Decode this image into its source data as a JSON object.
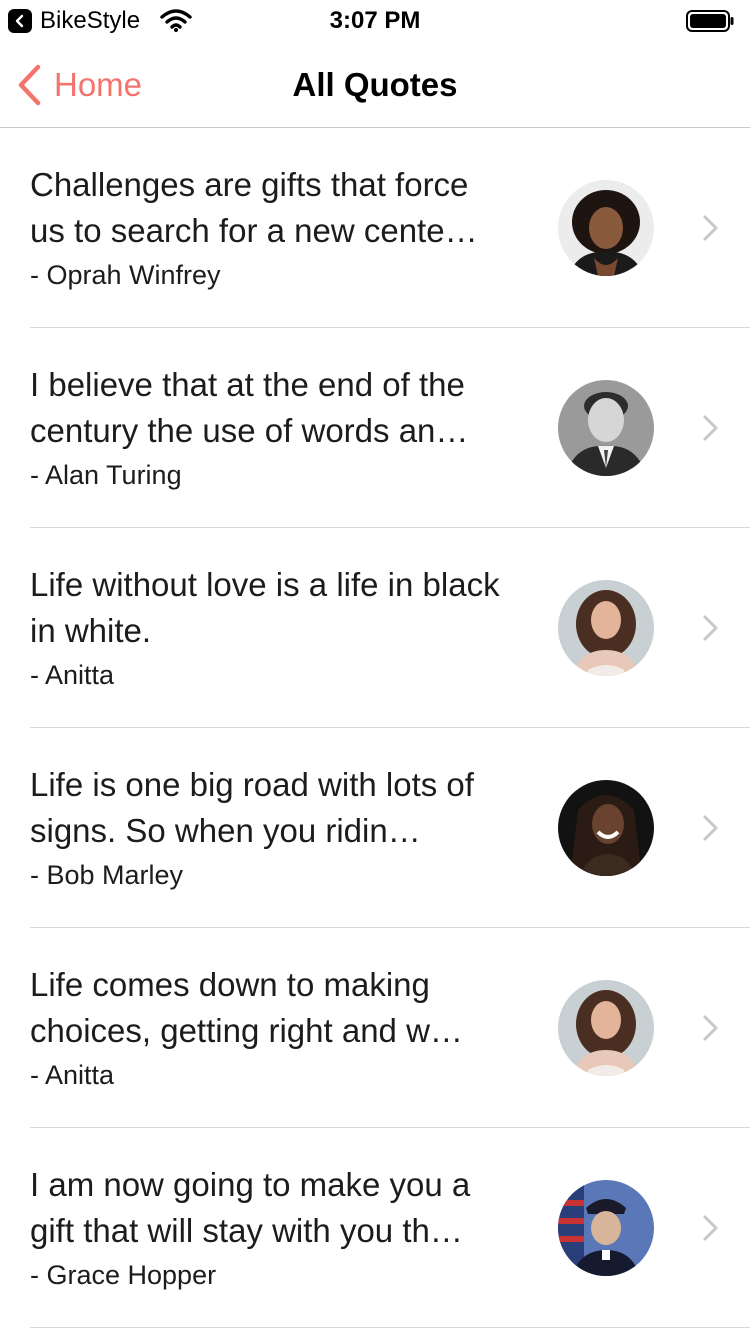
{
  "status_bar": {
    "app_name": "BikeStyle",
    "time": "3:07 PM",
    "back_icon": "back-triangle-icon",
    "wifi_icon": "wifi-icon",
    "battery_icon": "battery-icon"
  },
  "nav": {
    "back_label": "Home",
    "title": "All Quotes",
    "accent_color": "#f4736d"
  },
  "quotes": [
    {
      "text": "Challenges are gifts that force us to search for a new cente…",
      "author": "- Oprah Winfrey"
    },
    {
      "text": "I believe that at the end of the century the use of words an…",
      "author": "- Alan Turing"
    },
    {
      "text": "Life without love is a life in black in white.",
      "author": "- Anitta"
    },
    {
      "text": "Life is one big road with lots of signs. So when you ridin…",
      "author": "- Bob Marley"
    },
    {
      "text": "Life comes down to making choices, getting right and w…",
      "author": "- Anitta"
    },
    {
      "text": "I am now going to make you a gift that will stay with you th…",
      "author": "- Grace Hopper"
    }
  ]
}
